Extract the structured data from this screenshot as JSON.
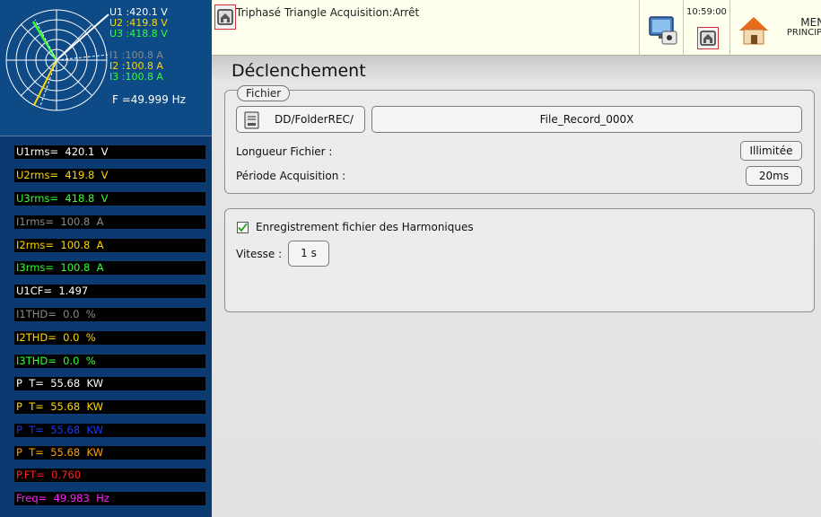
{
  "phasor": {
    "u1": "U1 :420.1 V",
    "u2": "U2 :419.8 V",
    "u3": "U3 :418.8 V",
    "i1": "I1 :100.8 A",
    "i2": "I2 :100.8 A",
    "i3": "I3 :100.8 A",
    "freq": "F  =49.999 Hz"
  },
  "measurements": [
    {
      "text": "U1rms=  420.1  V",
      "color": "#ffffff"
    },
    {
      "text": "U2rms=  419.8  V",
      "color": "#ffd700"
    },
    {
      "text": "U3rms=  418.8  V",
      "color": "#33ff33"
    },
    {
      "text": "I1rms=  100.8  A",
      "color": "#8a8a8a"
    },
    {
      "text": "I2rms=  100.8  A",
      "color": "#ffd700"
    },
    {
      "text": "I3rms=  100.8  A",
      "color": "#33ff33"
    },
    {
      "text": "U1CF=  1.497",
      "color": "#ffffff"
    },
    {
      "text": "I1THD=  0.0  %",
      "color": "#8a8a8a"
    },
    {
      "text": "I2THD=  0.0  %",
      "color": "#ffd700"
    },
    {
      "text": "I3THD=  0.0  %",
      "color": "#33ff33"
    },
    {
      "text": "P  T=  55.68  KW",
      "color": "#ffffff"
    },
    {
      "text": "P  T=  55.68  KW",
      "color": "#ffd700"
    },
    {
      "text": "P  T=  55.68  KW",
      "color": "#1a3aff"
    },
    {
      "text": "P  T=  55.68  KW",
      "color": "#ffa000"
    },
    {
      "text": "P.FT=  0.760",
      "color": "#ff2020"
    },
    {
      "text": "Freq=  49.983  Hz",
      "color": "#ff22ff"
    }
  ],
  "header": {
    "title": "Triphasé Triangle Acquisition:Arrêt",
    "time": "10:59:00",
    "menu_label_1": "MENU",
    "menu_label_2": "PRINCIPAL"
  },
  "page": {
    "title": "Déclenchement",
    "fichier_legend": "Fichier",
    "folder_button": "DD/FolderREC/",
    "file_name": "File_Record_000X",
    "longueur_label": "Longueur Fichier :",
    "longueur_value": "Illimitée",
    "periode_label": "Période Acquisition :",
    "periode_value": "20ms",
    "harmonics_label": "Enregistrement fichier des Harmoniques",
    "harmonics_checked": true,
    "vitesse_label": "Vitesse :",
    "vitesse_value": "1 s"
  },
  "colors": {
    "u1": "#ffffff",
    "u2": "#ffd700",
    "u3": "#33ff33",
    "i1": "#8a8a8a",
    "i2": "#ffd700",
    "i3": "#33ff33",
    "left_bg": "#0b3a70",
    "header_bg": "#ffffee"
  }
}
